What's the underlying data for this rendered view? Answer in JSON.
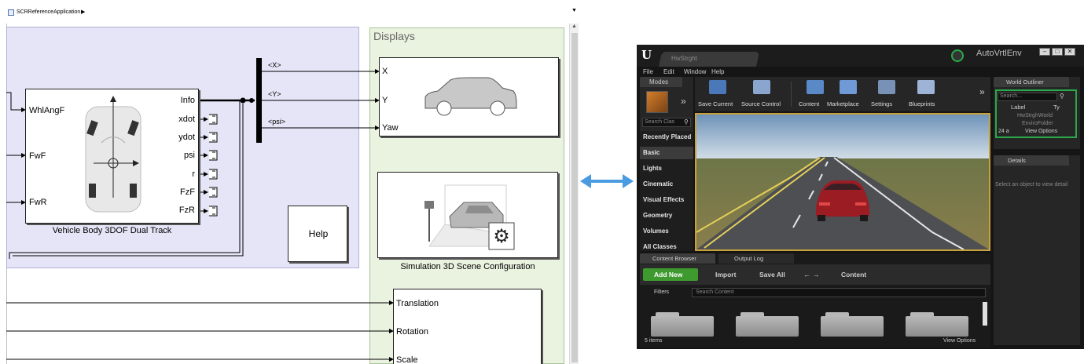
{
  "simulink": {
    "breadcrumb": "SCRReferenceApplication",
    "vehicle_block": {
      "inputs": [
        "WhlAngF",
        "FwF",
        "FwR"
      ],
      "outputs": [
        "Info",
        "xdot",
        "ydot",
        "psi",
        "r",
        "FzF",
        "FzR"
      ],
      "name": "Vehicle Body 3DOF Dual Track"
    },
    "bus_signals": [
      "<X>",
      "<Y>",
      "<psi>"
    ],
    "displays_label": "Displays",
    "car_block_inputs": [
      "X",
      "Y",
      "Yaw"
    ],
    "help_label": "Help",
    "scene_config_name": "Simulation 3D Scene Configuration",
    "transform_inputs": [
      "Translation",
      "Rotation",
      "Scale"
    ]
  },
  "unreal": {
    "tab_title": "HwStrght",
    "project_name": "AutoVrtlEnv",
    "menu": [
      "File",
      "Edit",
      "Window",
      "Help"
    ],
    "modes_label": "Modes",
    "search_classes_placeholder": "Search Clas",
    "mode_categories": [
      "Recently Placed",
      "Basic",
      "Lights",
      "Cinematic",
      "Visual Effects",
      "Geometry",
      "Volumes",
      "All Classes"
    ],
    "toolbar": [
      "Save Current",
      "Source Control",
      "Content",
      "Marketplace",
      "Settings",
      "Blueprints"
    ],
    "world_outliner": {
      "title": "World Outliner",
      "search_placeholder": "Search...",
      "col_label": "Label",
      "col_type": "Ty",
      "items": [
        "HwStrghWorld",
        "EnviroFolder"
      ],
      "count": "24 a",
      "view_options": "View Options"
    },
    "details": {
      "title": "Details",
      "empty_message": "Select an object to view detail"
    },
    "content_browser": {
      "tab_label": "Content Browser",
      "output_tab_label": "Output Log",
      "add_new": "Add New",
      "import": "Import",
      "save_all": "Save All",
      "path": "Content",
      "filters": "Filters",
      "search_placeholder": "Search Content",
      "item_count": "5 items",
      "view_options": "View Options"
    }
  }
}
